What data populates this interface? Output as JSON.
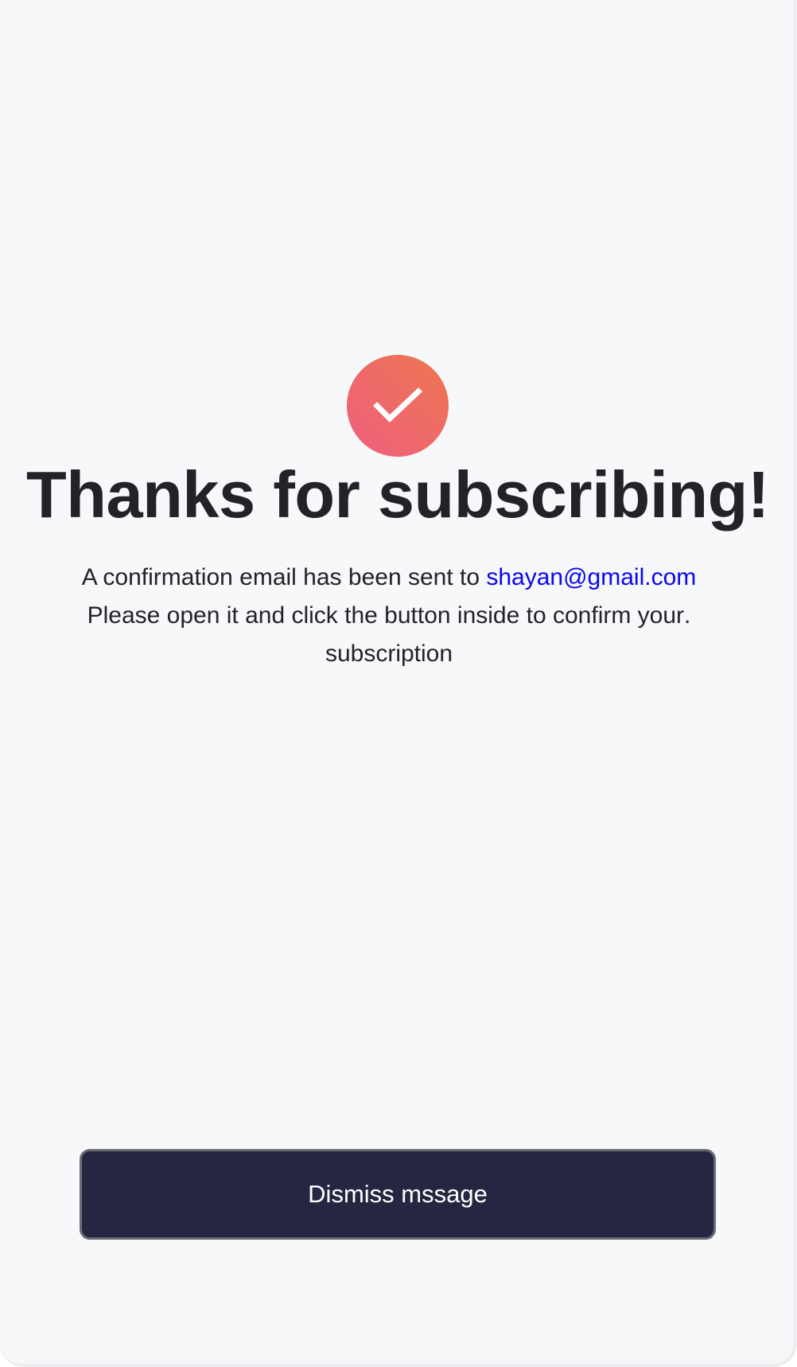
{
  "success": {
    "icon": "checkmark-icon",
    "gradient_start": "#ef5f7f",
    "gradient_end": "#ee7650"
  },
  "title": "Thanks for subscribing!",
  "message": {
    "line1_prefix": "A confirmation email has been sent to ",
    "email": "shayan@gmail.com",
    "line2": ".Please open it and click the button inside to confirm your",
    "line3": "subscription"
  },
  "colors": {
    "link": "#0b07f0",
    "button_bg": "#252641",
    "text": "#222327",
    "background": "#f7f8fa"
  },
  "dismiss_button": {
    "label": "Dismiss mssage"
  }
}
